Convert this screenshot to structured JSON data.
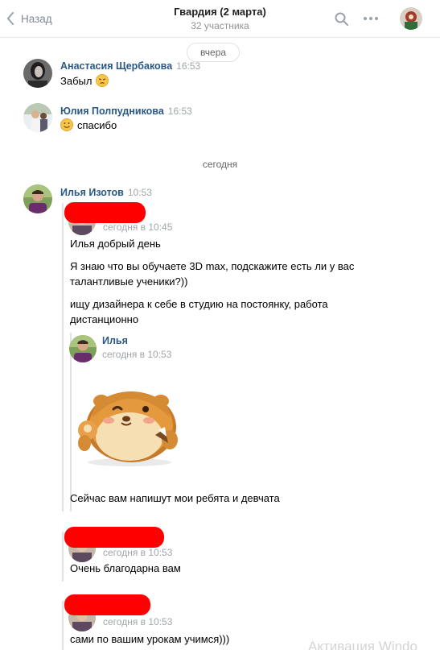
{
  "header": {
    "back_label": "Назад",
    "title": "Гвардия (2 марта)",
    "subtitle": "32 участника"
  },
  "dates": {
    "yesterday": "вчера",
    "today": "сегодня"
  },
  "messages": [
    {
      "author": "Анастасия Щербакова",
      "time": "16:53",
      "text": "Забыл",
      "emoji": "pensive-emoji"
    },
    {
      "author": "Юлия Полпудникова",
      "time": "16:53",
      "text": "спасибо",
      "emoji": "smile-emoji"
    },
    {
      "author": "Илья Изотов",
      "time": "10:53"
    }
  ],
  "forwarded": {
    "first": {
      "time": "сегодня в 10:45",
      "lines": [
        "Илья добрый день",
        "Я знаю что вы обучаете 3D max, подскажите есть ли у вас",
        "талантливые ученики?))",
        "ищу дизайнера к себе в студию на постоянку, работа",
        "дистанционно"
      ]
    },
    "nested": {
      "name": "Илья",
      "time": "сегодня в 10:53"
    },
    "sticker": "hamster-ok-sticker",
    "after_sticker": "Сейчас вам напишут мои ребята и девчата",
    "second": {
      "time": "сегодня в 10:53",
      "text": "Очень благодарна вам"
    },
    "third": {
      "time": "сегодня в 10:53",
      "text": "сами по вашим урокам учимся)))"
    }
  },
  "watermark": "Активация Windo",
  "colors": {
    "link": "#2a5885",
    "muted": "#a0a5ab",
    "redaction": "#ff0000"
  }
}
